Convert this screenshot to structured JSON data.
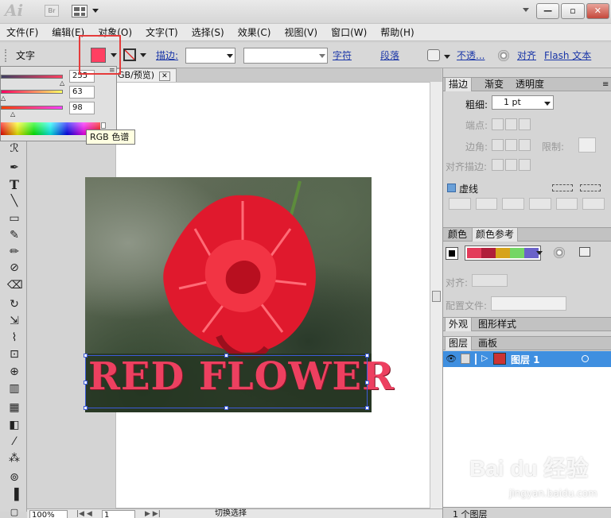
{
  "app": {
    "logo": "Ai",
    "bridge": "Br"
  },
  "window_controls": {
    "minimize": "—",
    "restore": "▫",
    "close": "✕"
  },
  "menu": [
    "文件(F)",
    "编辑(E)",
    "对象(O)",
    "文字(T)",
    "选择(S)",
    "效果(C)",
    "视图(V)",
    "窗口(W)",
    "帮助(H)"
  ],
  "control_bar": {
    "tool_label": "文字",
    "stroke_label": "描边:",
    "char_link": "字符",
    "para_link": "段落",
    "opacity_link": "不透...",
    "align_link": "对齐",
    "flash_link": "Flash 文本"
  },
  "color_panel": {
    "r": "255",
    "g": "63",
    "b": "98",
    "fill_color": "#ff3f62"
  },
  "tooltip": "RGB 色谱",
  "document": {
    "tab_label": "GB/预览)",
    "close_icon": "✕",
    "image_text": "RED FLOWER",
    "zoom": "100%",
    "page": "1",
    "status": "切换选择"
  },
  "stroke_panel": {
    "tabs": [
      "描边",
      "渐变",
      "透明度"
    ],
    "weight_label": "粗细:",
    "weight_value": "1 pt",
    "cap_label": "端点:",
    "corner_label": "边角:",
    "limit_label": "限制:",
    "align_label": "对齐描边:",
    "dashed_label": "虚线"
  },
  "color_guide": {
    "tabs": [
      "颜色",
      "颜色参考"
    ],
    "align_label": "对齐:",
    "profile_label": "配置文件:",
    "swatches": [
      "#e33b5a",
      "#b01e3a",
      "#d6a31a",
      "#74d665",
      "#6a62c9"
    ]
  },
  "appearance_tabs": [
    "外观",
    "图形样式"
  ],
  "layers_panel": {
    "tabs": [
      "图层",
      "画板"
    ],
    "layer_name": "图层 1",
    "layer_count": "1 个图层"
  },
  "watermark": {
    "brand": "Bai du 经验",
    "url": "jingyan.baidu.com"
  }
}
